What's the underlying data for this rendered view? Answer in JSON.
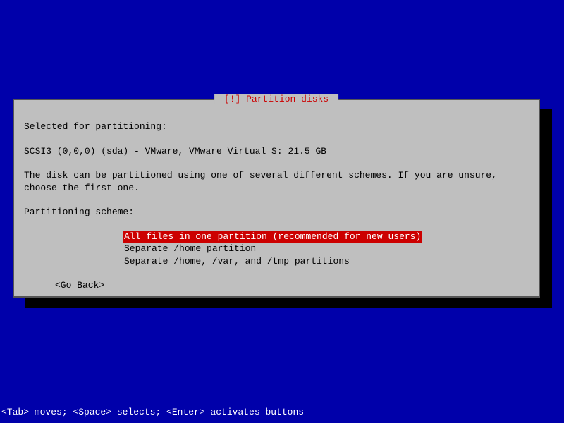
{
  "dialog": {
    "title": " [!] Partition disks ",
    "intro": "Selected for partitioning:",
    "disk_info": "SCSI3 (0,0,0) (sda) - VMware, VMware Virtual S: 21.5 GB",
    "description": "The disk can be partitioned using one of several different schemes. If you are unsure, choose the first one.",
    "scheme_label": "Partitioning scheme:",
    "options": [
      "All files in one partition (recommended for new users)",
      "Separate /home partition",
      "Separate /home, /var, and /tmp partitions"
    ],
    "selected_index": 0,
    "go_back": "<Go Back>"
  },
  "footer": "<Tab> moves; <Space> selects; <Enter> activates buttons"
}
